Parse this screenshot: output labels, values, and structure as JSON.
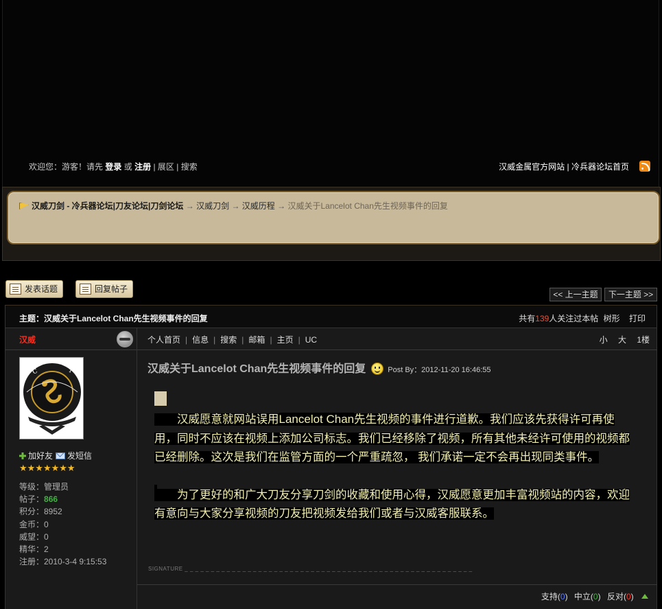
{
  "topbar": {
    "welcome": "欢迎您：游客！请先",
    "login": "登录",
    "or": "或",
    "register": "注册",
    "sep": "|",
    "exhibition": "展区",
    "search": "搜索",
    "official_site": "汉威金属官方网站",
    "forum_home": "冷兵器论坛首页"
  },
  "breadcrumb": {
    "forum": "汉威刀剑 - 冷兵器论坛|刀友论坛|刀剑论坛",
    "arrow": "→",
    "section": "汉威刀剑",
    "subsection": "汉威历程",
    "current": "汉威关于Lancelot Chan先生视频事件的回复"
  },
  "buttons": {
    "new_topic": "发表话题",
    "reply": "回复帖子",
    "prev_topic": "<< 上一主题",
    "next_topic": "下一主题 >>"
  },
  "thread": {
    "title": "主题：汉威关于Lancelot Chan先生视频事件的回复",
    "watch_prefix": "共有",
    "watch_count": "139",
    "watch_suffix": "人关注过本帖",
    "tree": "树形",
    "print": "打印"
  },
  "user": {
    "name": "汉威",
    "add_friend": "加好友",
    "send_message": "发短信",
    "stars": "★★★★★★★",
    "level": "等级：管理员",
    "posts_label": "帖子：",
    "posts": "866",
    "points": "积分：8952",
    "coins": "金币：0",
    "prestige": "威望：0",
    "essence": "精华：2",
    "registered": "注册：2010-3-4 9:15:53"
  },
  "post_menu": {
    "home": "个人首页",
    "info": "信息",
    "search": "搜索",
    "mail": "邮箱",
    "homepage": "主页",
    "uc": "UC",
    "sep": "|",
    "small": "小",
    "large": "大",
    "floor": "1楼"
  },
  "post": {
    "title": "汉威关于Lancelot Chan先生视频事件的回复",
    "post_by": "Post By：2012-11-20 16:46:55",
    "p1_a": "　　汉威愿意就网站误用",
    "p1_en": "Lancelot Chan",
    "p1_b": "先生视频的事件进行道歉。我们应该先获得许可再使用，同时不应该在视频上添加公司标志。我们已经移除了视频，所有其他未经许可使用的视频都已经删除。这次是我们在监管方面的一个严重疏忽， 我们承诺一定不会再出现同类事件。",
    "p2": "　　为了更好的和广大刀友分享刀剑的收藏和使用心得，汉威愿意更加丰富视频站的内容，欢迎有意向与大家分享视频的刀友把视频发给我们或者与汉威客服联系。",
    "signature": "SIGNATURE _ _ _ _ _ _ _ _ _ _ _ _ _ _ _ _ _ _ _ _ _ _ _ _ _ _ _ _ _ _ _ _ _ _ _ _ _ _ _ _ _ _ _ _ _ _ _ _ _ _ _ _ _ _ _"
  },
  "votes": {
    "support": "支持",
    "support_count": "0",
    "neutral": "中立",
    "neutral_count": "0",
    "oppose": "反对",
    "oppose_count": "0",
    "open_paren": "(",
    "close_paren": ")"
  },
  "colors": {
    "username": "#ff2a1a",
    "post_text": "#f0eeb0",
    "crumb_bg": "#c7b99a",
    "watch_count": "#e0533a"
  }
}
